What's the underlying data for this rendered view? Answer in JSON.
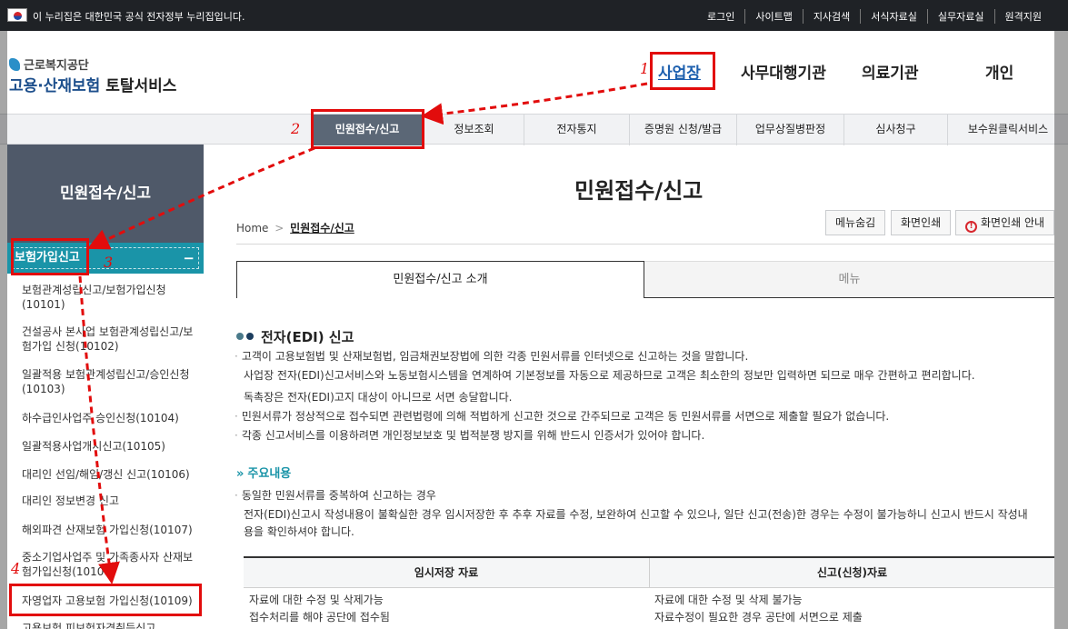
{
  "gov_bar": {
    "text": "이 누리집은 대한민국 공식 전자정부 누리집입니다.",
    "links": [
      "로그인",
      "사이트맵",
      "지사검색",
      "서식자료실",
      "실무자료실",
      "원격지원"
    ]
  },
  "header": {
    "logo_top": "근로복지공단",
    "logo_main_a": "고용·산재보험",
    "logo_main_b": " 토탈서비스",
    "user_tabs": [
      "사업장",
      "사무대행기관",
      "의료기관",
      "개인"
    ]
  },
  "gnb": [
    "민원접수/신고",
    "정보조회",
    "전자통지",
    "증명원 신청/발급",
    "업무상질병판정",
    "심사청구",
    "보수원클릭서비스"
  ],
  "sidebar": {
    "title": "민원접수/신고",
    "section": "보험가입신고",
    "section_toggle": "−",
    "items": [
      "보험관계성립신고/보험가입신청(10101)",
      "건설공사 본사업 보험관계성립신고/보험가입 신청(10102)",
      "일괄적용 보험관계성립신고/승인신청(10103)",
      "하수급인사업주 승인신청(10104)",
      "일괄적용사업개시신고(10105)",
      "대리인 선임/해임/갱신 신고(10106)",
      "대리인 정보변경 신고",
      "해외파견 산재보험 가입신청(10107)",
      "중소기업사업주 및 가족종사자 산재보험가입신청(10108)",
      "자영업자 고용보험 가입신청(10109)",
      "고용보험 피보험자격취득신고"
    ]
  },
  "content": {
    "title": "민원접수/신고",
    "breadcrumb_home": "Home",
    "breadcrumb_sep": ">",
    "breadcrumb_current": "민원접수/신고",
    "buttons": {
      "hide_menu": "메뉴숨김",
      "print": "화면인쇄",
      "print_guide": "화면인쇄 안내"
    },
    "tabs": [
      "민원접수/신고 소개",
      "메뉴"
    ],
    "section_title": "전자(EDI) 신고",
    "paragraphs": [
      "고객이 고용보험법 및 산재보험법, 임금채권보장법에 의한 각종 민원서류를 인터넷으로 신고하는 것을 말합니다.",
      "사업장 전자(EDI)신고서비스와 노동보험시스템을 연계하여 기본정보를 자동으로 제공하므로 고객은 최소한의 정보만 입력하면 되므로 매우 간편하고 편리합니다.",
      "독촉장은 전자(EDI)고지 대상이 아니므로 서면 송달합니다.",
      "민원서류가 정상적으로 접수되면 관련법령에 의해 적법하게 신고한 것으로 간주되므로 고객은 동 민원서류를 서면으로 제출할 필요가 없습니다.",
      "각종 신고서비스를 이용하려면 개인정보보호 및 법적분쟁 방지를 위해 반드시 인증서가 있어야 합니다."
    ],
    "sub_title": "주요내용",
    "sub_paragraphs": [
      "동일한 민원서류를 중복하여 신고하는 경우",
      "전자(EDI)신고시 작성내용이 불확실한 경우 임시저장한 후 추후 자료를 수정, 보완하여 신고할 수 있으나, 일단 신고(전송)한 경우는 수정이 불가능하니 신고시 반드시 작성내",
      "용을 확인하셔야 합니다."
    ],
    "table": {
      "headers": [
        "임시저장 자료",
        "신고(신청)자료"
      ],
      "rows": [
        [
          "자료에 대한 수정 및 삭제가능",
          "자료에 대한 수정 및 삭제 불가능"
        ],
        [
          "접수처리를 해야 공단에 접수됨",
          "자료수정이 필요한 경우 공단에 서면으로 제출"
        ]
      ]
    }
  },
  "annotations": {
    "steps": [
      "1",
      "2",
      "3",
      "4"
    ],
    "color": "#e20c0c"
  }
}
